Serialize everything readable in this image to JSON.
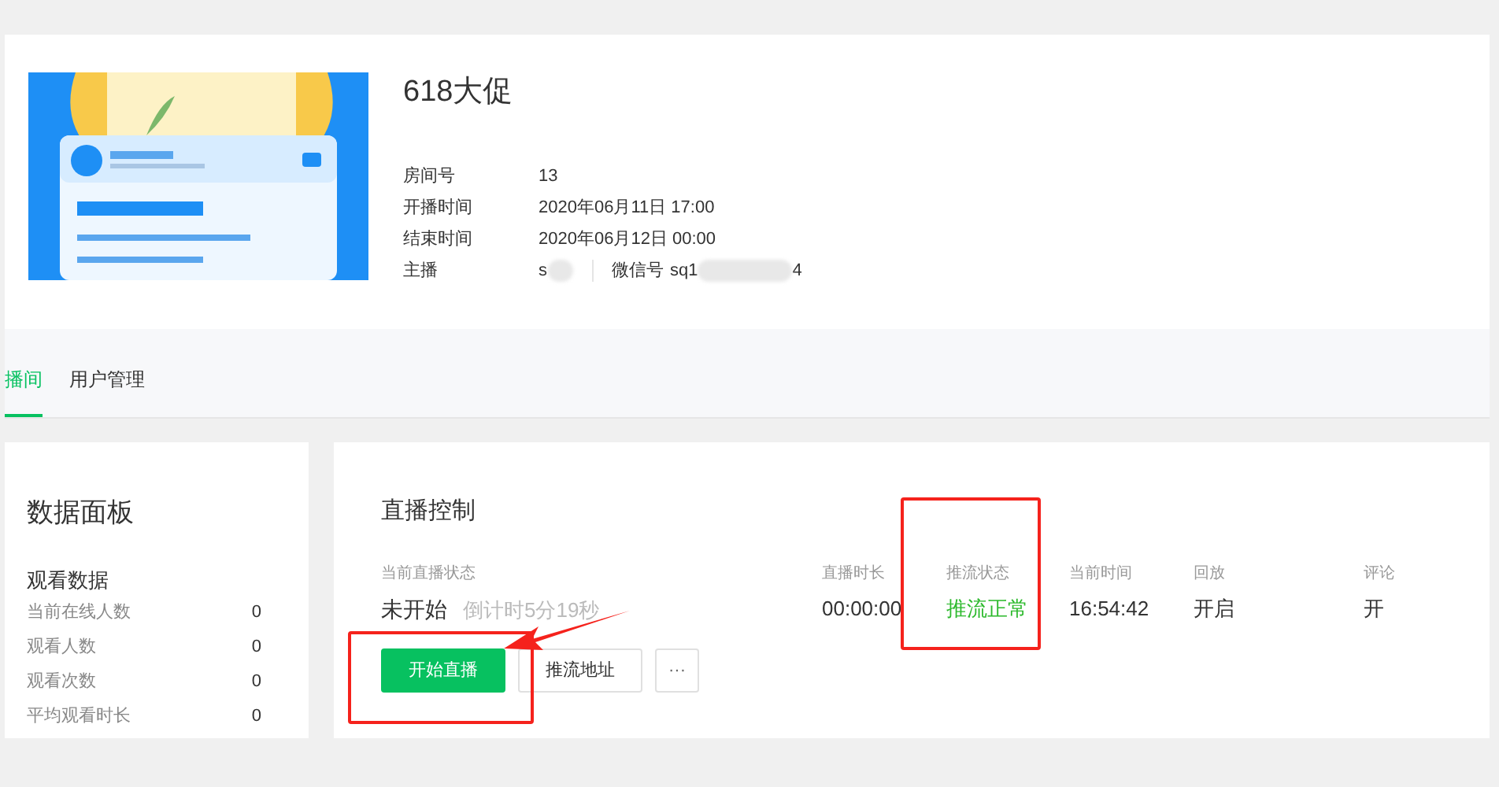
{
  "room": {
    "title": "618大促",
    "details": [
      {
        "label": "房间号",
        "value": "13"
      },
      {
        "label": "开播时间",
        "value": "2020年06月11日 17:00"
      },
      {
        "label": "结束时间",
        "value": "2020年06月12日 00:00"
      }
    ],
    "host": {
      "label": "主播",
      "value": "s",
      "wechat_label": "微信号",
      "wechat_value": "sq1",
      "wechat_suffix": "4"
    }
  },
  "tabs": [
    {
      "label": "播间",
      "selected": true
    },
    {
      "label": "用户管理",
      "selected": false
    }
  ],
  "data_panel": {
    "title": "数据面板",
    "section": "观看数据",
    "rows": [
      {
        "label": "当前在线人数",
        "value": "0"
      },
      {
        "label": "观看人数",
        "value": "0"
      },
      {
        "label": "观看次数",
        "value": "0"
      },
      {
        "label": "平均观看时长",
        "value": "0"
      }
    ]
  },
  "control": {
    "title": "直播控制",
    "status_label": "当前直播状态",
    "status": "未开始",
    "countdown": "倒计时5分19秒",
    "metrics": [
      {
        "label": "直播时长",
        "value": "00:00:00",
        "highlighted": false
      },
      {
        "label": "推流状态",
        "value": "推流正常",
        "highlighted": true
      },
      {
        "label": "当前时间",
        "value": "16:54:42",
        "highlighted": false
      },
      {
        "label": "回放",
        "value": "开启",
        "highlighted": false
      },
      {
        "label": "评论",
        "value": "开",
        "highlighted": false
      }
    ],
    "buttons": [
      {
        "kind": "primary",
        "label": "开始直播"
      },
      {
        "kind": "secondary",
        "label": "推流地址"
      },
      {
        "kind": "more",
        "label": "···"
      }
    ]
  }
}
